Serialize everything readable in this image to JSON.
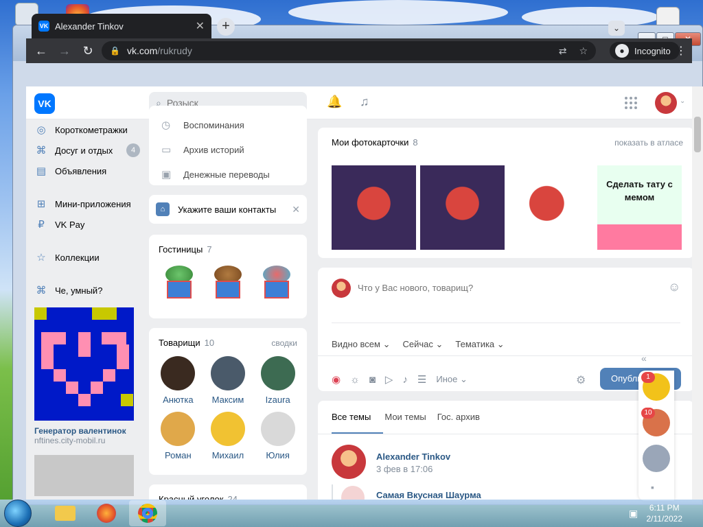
{
  "browser": {
    "tab_title": "Alexander Tinkov",
    "tab_favicon": "VK",
    "url_host": "vk.com",
    "url_path": "/rukrudy",
    "incognito_label": "Incognito"
  },
  "vk": {
    "logo": "VK",
    "search_placeholder": "Розыск"
  },
  "sidebar": {
    "items": [
      {
        "label": "Короткометражки",
        "icon": "clip-icon"
      },
      {
        "label": "Досуг и отдых",
        "icon": "gamepad-icon",
        "badge": "4"
      },
      {
        "label": "Объявления",
        "icon": "ads-icon"
      },
      {
        "label": "Мини-приложения",
        "icon": "apps-icon"
      },
      {
        "label": "VK Pay",
        "icon": "vkpay-icon"
      },
      {
        "label": "Коллекции",
        "icon": "star-icon"
      },
      {
        "label": "Че, умный?",
        "icon": "gamepad-icon"
      }
    ],
    "ad": {
      "title": "Генератор валентинок",
      "subtitle": "nftines.city-mobil.ru"
    }
  },
  "menu_card": {
    "items": [
      {
        "label": "Воспоминания",
        "icon": "history-icon"
      },
      {
        "label": "Архив историй",
        "icon": "archive-icon"
      },
      {
        "label": "Денежные переводы",
        "icon": "money-icon"
      }
    ]
  },
  "contacts_banner": {
    "label": "Укажите ваши контакты"
  },
  "gifts": {
    "title": "Гостиницы",
    "count": "7"
  },
  "friends": {
    "title": "Товарищи",
    "count": "10",
    "link": "сводки",
    "people": [
      {
        "name": "Анютка",
        "color": "#3a2a20"
      },
      {
        "name": "Максим",
        "color": "#4a5a6a"
      },
      {
        "name": "Izaura",
        "color": "#3d6b52"
      },
      {
        "name": "Роман",
        "color": "#e0a84a"
      },
      {
        "name": "Михаил",
        "color": "#f1c232"
      },
      {
        "name": "Юлия",
        "color": "#d9d9d9"
      }
    ]
  },
  "next_card": {
    "title": "Красный уголок",
    "count": "24"
  },
  "photos": {
    "title": "Мои фотокарточки",
    "count": "8",
    "link": "показать в атласе",
    "last_caption": "Сделать тату с мемом"
  },
  "composer": {
    "placeholder": "Что у Вас нового, товарищ?",
    "filters": [
      "Видно всем",
      "Сейчас",
      "Тематика"
    ],
    "more": "Иное",
    "publish": "Опубли"
  },
  "feed_tabs": {
    "tabs": [
      "Все темы",
      "Мои темы",
      "Гос. архив"
    ]
  },
  "post": {
    "author": "Alexander Tinkov",
    "time": "3 фев в 17:06",
    "repost_title": "Самая Вкусная Шаурма"
  },
  "chats": [
    {
      "badge": "1",
      "color": "#e8c020"
    },
    {
      "badge": "10",
      "color": "#d9724a"
    },
    {
      "badge": "",
      "color": "#9aa6b8"
    }
  ],
  "taskbar": {
    "time": "6:11 PM",
    "date": "2/11/2022"
  },
  "colors": {
    "vk_blue": "#0077ff",
    "accent": "#5181b8",
    "badge_red": "#e64646"
  }
}
